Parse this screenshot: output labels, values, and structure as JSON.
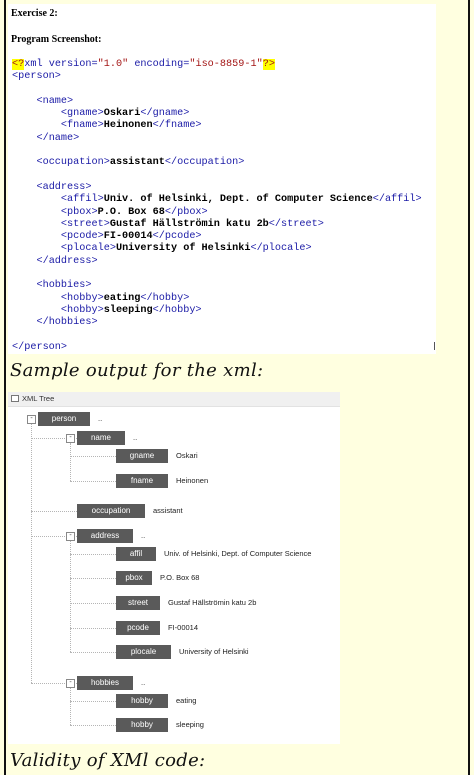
{
  "document": {
    "exercise_title": "Exercise 2:",
    "screenshot_label": "Program Screenshot:",
    "xml_lines": [
      [
        {
          "t": "pi",
          "v": "<?"
        },
        {
          "t": "tag",
          "v": "xml "
        },
        {
          "t": "attr",
          "v": "version="
        },
        {
          "t": "str",
          "v": "\"1.0\""
        },
        {
          "t": "attr",
          "v": " encoding="
        },
        {
          "t": "str",
          "v": "\"iso-8859-1\""
        },
        {
          "t": "pi",
          "v": "?>"
        }
      ],
      [
        {
          "t": "tag",
          "v": "<person>"
        }
      ],
      [],
      [
        {
          "t": "txt",
          "v": "    "
        },
        {
          "t": "tag",
          "v": "<name>"
        }
      ],
      [
        {
          "t": "txt",
          "v": "        "
        },
        {
          "t": "tag",
          "v": "<gname>"
        },
        {
          "t": "val",
          "v": "Oskari"
        },
        {
          "t": "tag",
          "v": "</gname>"
        }
      ],
      [
        {
          "t": "txt",
          "v": "        "
        },
        {
          "t": "tag",
          "v": "<fname>"
        },
        {
          "t": "val",
          "v": "Heinonen"
        },
        {
          "t": "tag",
          "v": "</fname>"
        }
      ],
      [
        {
          "t": "txt",
          "v": "    "
        },
        {
          "t": "tag",
          "v": "</name>"
        }
      ],
      [],
      [
        {
          "t": "txt",
          "v": "    "
        },
        {
          "t": "tag",
          "v": "<occupation>"
        },
        {
          "t": "val",
          "v": "assistant"
        },
        {
          "t": "tag",
          "v": "</occupation>"
        }
      ],
      [],
      [
        {
          "t": "txt",
          "v": "    "
        },
        {
          "t": "tag",
          "v": "<address>"
        }
      ],
      [
        {
          "t": "txt",
          "v": "        "
        },
        {
          "t": "tag",
          "v": "<affil>"
        },
        {
          "t": "val",
          "v": "Univ. of Helsinki, Dept. of Computer Science"
        },
        {
          "t": "tag",
          "v": "</affil>"
        }
      ],
      [
        {
          "t": "txt",
          "v": "        "
        },
        {
          "t": "tag",
          "v": "<pbox>"
        },
        {
          "t": "val",
          "v": "P.O. Box 68"
        },
        {
          "t": "tag",
          "v": "</pbox>"
        }
      ],
      [
        {
          "t": "txt",
          "v": "        "
        },
        {
          "t": "tag",
          "v": "<street>"
        },
        {
          "t": "val",
          "v": "Gustaf Hällströmin katu 2b"
        },
        {
          "t": "tag",
          "v": "</street>"
        }
      ],
      [
        {
          "t": "txt",
          "v": "        "
        },
        {
          "t": "tag",
          "v": "<pcode>"
        },
        {
          "t": "val",
          "v": "FI-00014"
        },
        {
          "t": "tag",
          "v": "</pcode>"
        }
      ],
      [
        {
          "t": "txt",
          "v": "        "
        },
        {
          "t": "tag",
          "v": "<plocale>"
        },
        {
          "t": "val",
          "v": "University of Helsinki"
        },
        {
          "t": "tag",
          "v": "</plocale>"
        }
      ],
      [
        {
          "t": "txt",
          "v": "    "
        },
        {
          "t": "tag",
          "v": "</address>"
        }
      ],
      [],
      [
        {
          "t": "txt",
          "v": "    "
        },
        {
          "t": "tag",
          "v": "<hobbies>"
        }
      ],
      [
        {
          "t": "txt",
          "v": "        "
        },
        {
          "t": "tag",
          "v": "<hobby>"
        },
        {
          "t": "val",
          "v": "eating"
        },
        {
          "t": "tag",
          "v": "</hobby>"
        }
      ],
      [
        {
          "t": "txt",
          "v": "        "
        },
        {
          "t": "tag",
          "v": "<hobby>"
        },
        {
          "t": "val",
          "v": "sleeping"
        },
        {
          "t": "tag",
          "v": "</hobby>"
        }
      ],
      [
        {
          "t": "txt",
          "v": "    "
        },
        {
          "t": "tag",
          "v": "</hobbies>"
        }
      ],
      [],
      [
        {
          "t": "tag",
          "v": "</person>"
        }
      ]
    ]
  },
  "sample_output_heading": "Sample output for the xml:",
  "xml_tree": {
    "title": "XML Tree",
    "nodes": [
      {
        "id": "person",
        "label": "person",
        "value": "..",
        "toggle": "-"
      },
      {
        "id": "name",
        "label": "name",
        "value": "..",
        "toggle": "-"
      },
      {
        "id": "gname",
        "label": "gname",
        "value": "Oskari"
      },
      {
        "id": "fname",
        "label": "fname",
        "value": "Heinonen"
      },
      {
        "id": "occupation",
        "label": "occupation",
        "value": "assistant"
      },
      {
        "id": "address",
        "label": "address",
        "value": "..",
        "toggle": "-"
      },
      {
        "id": "affil",
        "label": "affil",
        "value": "Univ. of Helsinki, Dept. of Computer Science"
      },
      {
        "id": "pbox",
        "label": "pbox",
        "value": "P.O. Box 68"
      },
      {
        "id": "street",
        "label": "street",
        "value": "Gustaf Hällströmin katu 2b"
      },
      {
        "id": "pcode",
        "label": "pcode",
        "value": "FI-00014"
      },
      {
        "id": "plocale",
        "label": "plocale",
        "value": "University of Helsinki"
      },
      {
        "id": "hobbies",
        "label": "hobbies",
        "value": "..",
        "toggle": "-"
      },
      {
        "id": "hobby1",
        "label": "hobby",
        "value": "eating"
      },
      {
        "id": "hobby2",
        "label": "hobby",
        "value": "sleeping"
      }
    ]
  },
  "validity_heading": "Validity of XMl code:"
}
